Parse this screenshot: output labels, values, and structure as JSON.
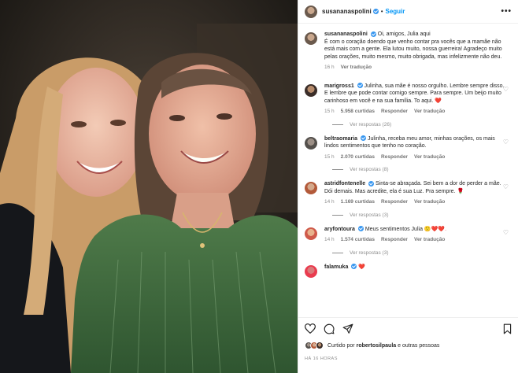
{
  "post": {
    "author": "susananaspolini",
    "follow_label": "Seguir",
    "separator": "•",
    "more_label": "•••"
  },
  "caption": {
    "username": "susananaspolini",
    "text": "Oi, amigos, Julia aqui\nÉ com o coração doendo que venho contar pra vocês que a mamãe não está mais com a gente. Ela lutou muito, nossa guerreira! Agradeço muito pelas orações, muito mesmo, muito obrigada, mas infelizmente não deu.",
    "time": "16 h",
    "translate_label": "Ver tradução"
  },
  "comments": [
    {
      "username": "marigross1",
      "text": "Julinha, sua mãe é nosso orgulho. Lembre sempre disso. E lembre que pode contar comigo sempre. Para sempre. Um beijo muito carinhoso em você e na sua família. To aqui.",
      "emoji": "❤️",
      "time": "15 h",
      "likes": "5.958 curtidas",
      "reply_label": "Responder",
      "translate_label": "Ver tradução",
      "replies_label": "Ver respostas (26)"
    },
    {
      "username": "beltraomaria",
      "text": "Julinha, receba meu amor, minhas orações, os mais lindos sentimentos que tenho no coração.",
      "emoji": "",
      "time": "15 h",
      "likes": "2.070 curtidas",
      "reply_label": "Responder",
      "translate_label": "Ver tradução",
      "replies_label": "Ver respostas (8)"
    },
    {
      "username": "astridfontenelle",
      "text": "Sinta-se abraçada. Sei bem a dor de perder a mãe. Dói demais. Mas acredite, ela é sua Luz. Pra sempre.",
      "emoji": "🌹",
      "time": "14 h",
      "likes": "1.169 curtidas",
      "reply_label": "Responder",
      "translate_label": "Ver tradução",
      "replies_label": "Ver respostas (3)"
    },
    {
      "username": "aryfontoura",
      "text": "Meus sentimentos Julia",
      "emoji": "🙁❤️❤️.",
      "time": "14 h",
      "likes": "1.574 curtidas",
      "reply_label": "Responder",
      "translate_label": "Ver tradução",
      "replies_label": "Ver respostas (3)"
    },
    {
      "username": "falamuka",
      "text": "",
      "emoji": "❤️",
      "time": "",
      "likes": "",
      "reply_label": "",
      "translate_label": "",
      "replies_label": ""
    }
  ],
  "actions": {
    "like_icon": "heart-icon",
    "comment_icon": "comment-icon",
    "share_icon": "share-icon",
    "save_icon": "bookmark-icon"
  },
  "likes_line": {
    "prefix": "Curtido por",
    "user": "robertosilpaula",
    "suffix": "e outras pessoas"
  },
  "post_time": "HÁ 16 HORAS",
  "colors": {
    "link_blue": "#0095f6",
    "verified_blue": "#3897f0",
    "muted_gray": "#8e8e8e",
    "heart_red": "#ed4956"
  }
}
